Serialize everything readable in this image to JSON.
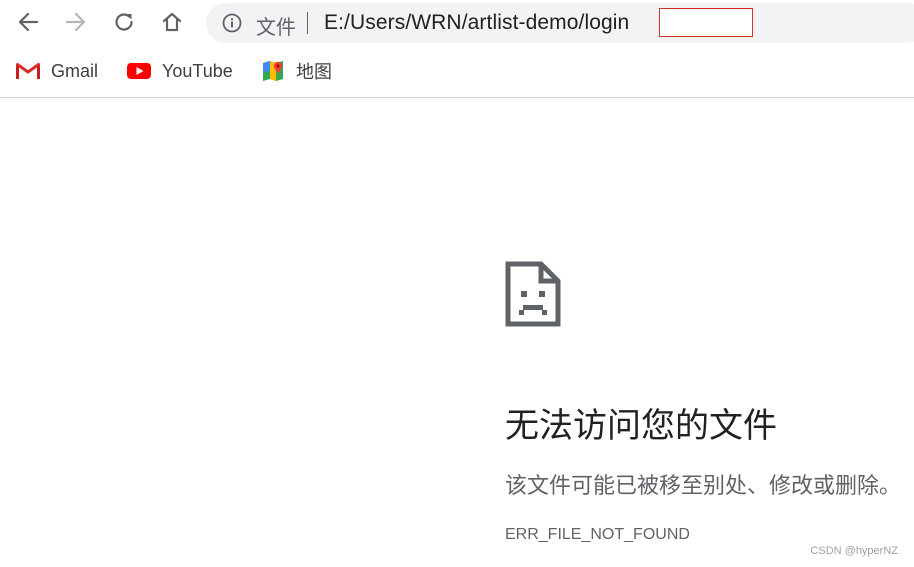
{
  "toolbar": {
    "back_icon": "arrow-left-icon",
    "forward_icon": "arrow-right-icon",
    "reload_icon": "reload-icon",
    "home_icon": "home-icon"
  },
  "omnibox": {
    "info_icon": "info-icon",
    "scheme_label": "文件",
    "url": "E:/Users/WRN/artlist-demo/login",
    "redaction_color": "#d93025"
  },
  "bookmarks": [
    {
      "label": "Gmail",
      "icon": "gmail-icon"
    },
    {
      "label": "YouTube",
      "icon": "youtube-icon"
    },
    {
      "label": "地图",
      "icon": "maps-icon"
    }
  ],
  "error_page": {
    "icon": "sad-file-icon",
    "title": "无法访问您的文件",
    "subtitle": "该文件可能已被移至别处、修改或删除。",
    "code": "ERR_FILE_NOT_FOUND"
  },
  "watermark": "CSDN @hyperNZ"
}
